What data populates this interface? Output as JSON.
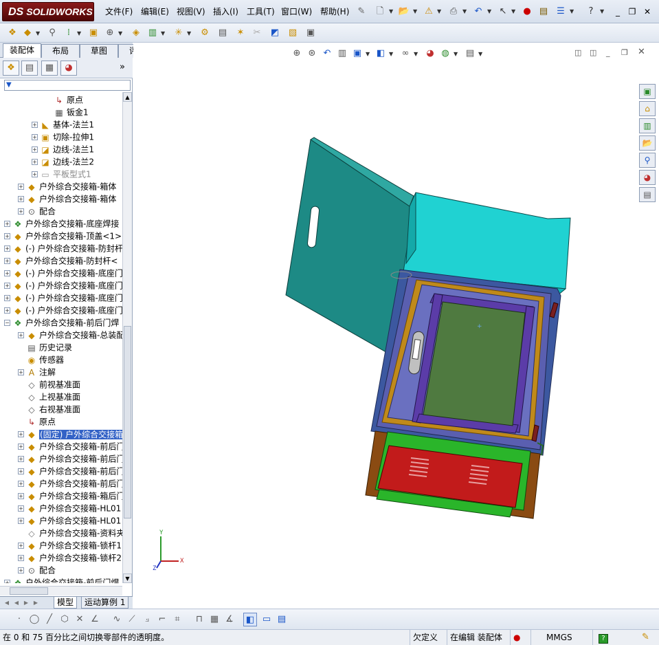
{
  "app": {
    "logo_text": "SOLIDWORKS",
    "logo_prefix": "DS"
  },
  "menus": [
    "文件(F)",
    "编辑(E)",
    "视图(V)",
    "插入(I)",
    "工具(T)",
    "窗口(W)",
    "帮助(H)"
  ],
  "command_tabs": [
    "装配体",
    "布局",
    "草图",
    "评估"
  ],
  "active_command_tab": "装配体",
  "filter_label": "▼",
  "tree": [
    {
      "label": "原点",
      "indent": 3,
      "icon": "origin-icon",
      "glyph": "↳",
      "exp": false
    },
    {
      "label": "钣金1",
      "indent": 3,
      "icon": "sheetmetal-icon",
      "glyph": "▦",
      "exp": false
    },
    {
      "label": "基体-法兰1",
      "indent": 2,
      "icon": "base-flange-icon",
      "glyph": "◣",
      "exp": true
    },
    {
      "label": "切除-拉伸1",
      "indent": 2,
      "icon": "cut-extrude-icon",
      "glyph": "▣",
      "exp": true
    },
    {
      "label": "边线-法兰1",
      "indent": 2,
      "icon": "edge-flange-icon",
      "glyph": "◪",
      "exp": true
    },
    {
      "label": "边线-法兰2",
      "indent": 2,
      "icon": "edge-flange-icon",
      "glyph": "◪",
      "exp": true
    },
    {
      "label": "平板型式1",
      "indent": 2,
      "icon": "flat-pattern-icon",
      "glyph": "▭",
      "exp": true,
      "grey": true
    },
    {
      "label": "户外综合交接箱-箱体 ",
      "indent": 1,
      "icon": "part-icon",
      "glyph": "◆",
      "exp": true
    },
    {
      "label": "户外综合交接箱-箱体 ",
      "indent": 1,
      "icon": "part-icon",
      "glyph": "◆",
      "exp": true
    },
    {
      "label": "配合",
      "indent": 1,
      "icon": "mates-icon",
      "glyph": "⊙",
      "exp": true
    },
    {
      "label": "户外综合交接箱-底座焊接",
      "indent": 0,
      "icon": "subassembly-icon",
      "glyph": "❖",
      "exp": true
    },
    {
      "label": "户外综合交接箱-顶盖<1>",
      "indent": 0,
      "icon": "part-icon",
      "glyph": "◆",
      "exp": true
    },
    {
      "label": "(-) 户外综合交接箱-防封杆",
      "indent": 0,
      "icon": "part-icon",
      "glyph": "◆",
      "exp": true
    },
    {
      "label": "户外综合交接箱-防封杆<",
      "indent": 0,
      "icon": "part-icon",
      "glyph": "◆",
      "exp": true
    },
    {
      "label": "(-) 户外综合交接箱-底座门",
      "indent": 0,
      "icon": "part-icon",
      "glyph": "◆",
      "exp": true
    },
    {
      "label": "(-) 户外综合交接箱-底座门",
      "indent": 0,
      "icon": "part-icon",
      "glyph": "◆",
      "exp": true
    },
    {
      "label": "(-) 户外综合交接箱-底座门",
      "indent": 0,
      "icon": "part-icon",
      "glyph": "◆",
      "exp": true
    },
    {
      "label": "(-) 户外综合交接箱-底座门",
      "indent": 0,
      "icon": "part-icon",
      "glyph": "◆",
      "exp": true
    },
    {
      "label": "户外综合交接箱-前后门焊",
      "indent": 0,
      "icon": "subassembly-icon",
      "glyph": "❖",
      "exp": true,
      "open": true
    },
    {
      "label": "户外综合交接箱-总装配",
      "indent": 1,
      "icon": "part-icon",
      "glyph": "◆",
      "exp": true
    },
    {
      "label": "历史记录",
      "indent": 1,
      "icon": "history-icon",
      "glyph": "▤",
      "exp": false
    },
    {
      "label": "传感器",
      "indent": 1,
      "icon": "sensor-icon",
      "glyph": "◉",
      "exp": false
    },
    {
      "label": "注解",
      "indent": 1,
      "icon": "annotations-icon",
      "glyph": "A",
      "exp": true
    },
    {
      "label": "前视基准面",
      "indent": 1,
      "icon": "plane-icon",
      "glyph": "◇",
      "exp": false
    },
    {
      "label": "上视基准面",
      "indent": 1,
      "icon": "plane-icon",
      "glyph": "◇",
      "exp": false
    },
    {
      "label": "右视基准面",
      "indent": 1,
      "icon": "plane-icon",
      "glyph": "◇",
      "exp": false
    },
    {
      "label": "原点",
      "indent": 1,
      "icon": "origin-icon",
      "glyph": "↳",
      "exp": false
    },
    {
      "label": "(固定) 户外综合交接箱",
      "indent": 1,
      "icon": "part-icon",
      "glyph": "◆",
      "exp": true,
      "sel": true
    },
    {
      "label": "户外综合交接箱-前后门",
      "indent": 1,
      "icon": "part-icon",
      "glyph": "◆",
      "exp": true
    },
    {
      "label": "户外综合交接箱-前后门",
      "indent": 1,
      "icon": "part-icon",
      "glyph": "◆",
      "exp": true
    },
    {
      "label": "户外综合交接箱-前后门",
      "indent": 1,
      "icon": "part-icon",
      "glyph": "◆",
      "exp": true
    },
    {
      "label": "户外综合交接箱-前后门",
      "indent": 1,
      "icon": "part-icon",
      "glyph": "◆",
      "exp": true
    },
    {
      "label": "户外综合交接箱-箱后门",
      "indent": 1,
      "icon": "part-icon",
      "glyph": "◆",
      "exp": true
    },
    {
      "label": "户外综合交接箱-HL01",
      "indent": 1,
      "icon": "part-icon",
      "glyph": "◆",
      "exp": true
    },
    {
      "label": "户外综合交接箱-HL01",
      "indent": 1,
      "icon": "part-icon",
      "glyph": "◆",
      "exp": true
    },
    {
      "label": "户外综合交接箱-资料夹",
      "indent": 1,
      "icon": "part-icon-outline",
      "glyph": "◇",
      "exp": false
    },
    {
      "label": "户外综合交接箱-锁杆1",
      "indent": 1,
      "icon": "part-icon",
      "glyph": "◆",
      "exp": true
    },
    {
      "label": "户外综合交接箱-锁杆2",
      "indent": 1,
      "icon": "part-icon",
      "glyph": "◆",
      "exp": true
    },
    {
      "label": "配合",
      "indent": 1,
      "icon": "mates-icon",
      "glyph": "⊙",
      "exp": true
    },
    {
      "label": "户外综合交接箱-前后门焊",
      "indent": 0,
      "icon": "subassembly-icon",
      "glyph": "❖",
      "exp": true
    }
  ],
  "bottom_tabs": [
    "模型",
    "运动算例 1"
  ],
  "status": {
    "message": "在 0 和 75 百分比之间切换零部件的透明度。",
    "definition": "欠定义",
    "editing": "在编辑 装配体",
    "units": "MMGS",
    "help": "?"
  },
  "triad": {
    "x": "X",
    "y": "Y",
    "z": "Z"
  },
  "colors": {
    "door": "#1d8a85",
    "cover": "#20d2d2",
    "frame_purple": "#5b3ca8",
    "panel_green": "#4f7a40",
    "base_red": "#c21b1b",
    "base_green": "#2ab52a",
    "base_brown": "#8a4b12",
    "selection": "#3362c6"
  }
}
